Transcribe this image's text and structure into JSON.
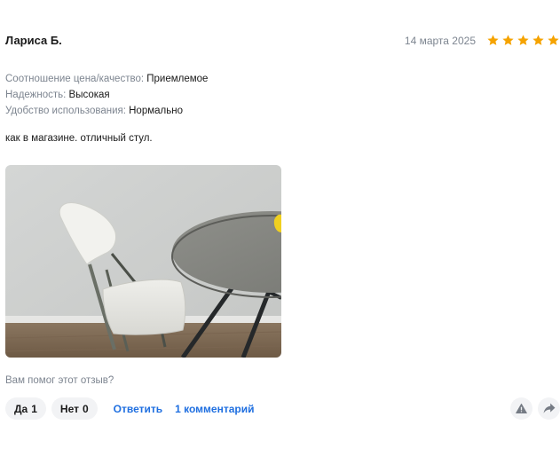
{
  "review": {
    "author": "Лариса Б.",
    "date": "14 марта 2025",
    "rating": 5,
    "star_color": "#f5a300",
    "attributes": [
      {
        "key": "Соотношение цена/качество:",
        "value": "Приемлемое"
      },
      {
        "key": "Надежность:",
        "value": "Высокая"
      },
      {
        "key": "Удобство использования:",
        "value": "Нормально"
      }
    ],
    "text": "как в магазине. отличный стул.",
    "photo": {
      "subject": "white folding chair next to round grey table"
    }
  },
  "feedback": {
    "question": "Вам помог этот отзыв?",
    "yes_label": "Да",
    "yes_count": "1",
    "no_label": "Нет",
    "no_count": "0",
    "reply_label": "Ответить",
    "comments_label": "1 комментарий",
    "report_icon": "warning-icon",
    "share_icon": "share-icon",
    "link_color": "#1f6fe0"
  }
}
